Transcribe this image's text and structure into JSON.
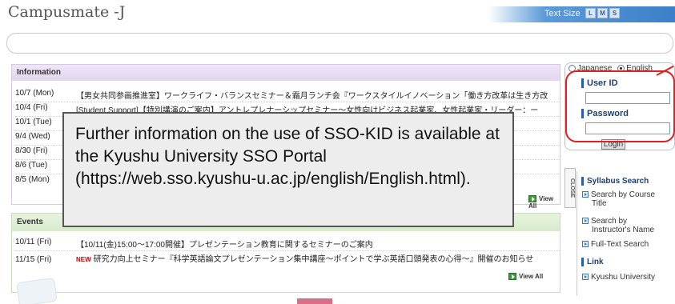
{
  "header": {
    "brand": "Campusmate -J",
    "text_size_label": "Text Size",
    "sizes": [
      "L",
      "M",
      "S"
    ]
  },
  "info": {
    "heading": "Information",
    "rows": [
      {
        "date": "10/7 (Mon)",
        "title": "【男女共同参画推進室】ワークライフ・バランスセミナー＆霜月ランチ会『ワークスタイルイノベーション「働き方改革は生き方改"
      },
      {
        "date": "10/4 (Fri)",
        "title": "[Student Support]【特別講演のご案内】アントレプレナーシップセミナー～女性向けビジネス起業家、女性起業家・リーダー：ー"
      },
      {
        "date": "10/1 (Tue)",
        "title": ""
      },
      {
        "date": "9/4 (Wed)",
        "title": ""
      },
      {
        "date": "8/30 (Fri)",
        "title": ""
      },
      {
        "date": "8/6 (Tue)",
        "title": ""
      },
      {
        "date": "8/5 (Mon)",
        "title": ""
      }
    ],
    "view_all": "View All"
  },
  "events": {
    "heading": "Events",
    "rows": [
      {
        "date": "10/11 (Fri)",
        "new": "",
        "title": "【10/11(金)15:00～17:00開催】プレゼンテーション教育に関するセミナーのご案内"
      },
      {
        "date": "11/15 (Fri)",
        "new": "NEW",
        "title": "研究力向上セミナー『科学英語論文プレゼンテーション集中講座～ポイントで学ぶ英語口頭発表の心得～』開催のお知らせ"
      }
    ],
    "view_all": "View All"
  },
  "login": {
    "lang_japanese": "Japanese",
    "lang_english": "English",
    "selected_lang": "English",
    "user_id_label": "User ID",
    "user_id_value": "",
    "password_label": "Password",
    "password_value": "",
    "login_button": "Login"
  },
  "side": {
    "close_tab": "CLOSE",
    "syllabus_heading": "Syllabus Search",
    "syllabus_links": [
      {
        "line1": "Search by Course",
        "line2": "Title"
      },
      {
        "line1": "Search by",
        "line2": "Instructor's Name"
      },
      {
        "line1": "Full-Text Search",
        "line2": ""
      }
    ],
    "link_heading": "Link",
    "link_items": [
      "Kyushu University"
    ]
  },
  "overlay": {
    "text": "Further information on the use of SSO-KID is available at the Kyushu University SSO Portal (https://web.sso.kyushu-u.ac.jp/english/English.html)."
  },
  "colors": {
    "annotation_ring": "#e02020",
    "info_header": "#e3d6ef",
    "events_header": "#d7eacc",
    "accent_blue": "#2b5da8"
  }
}
